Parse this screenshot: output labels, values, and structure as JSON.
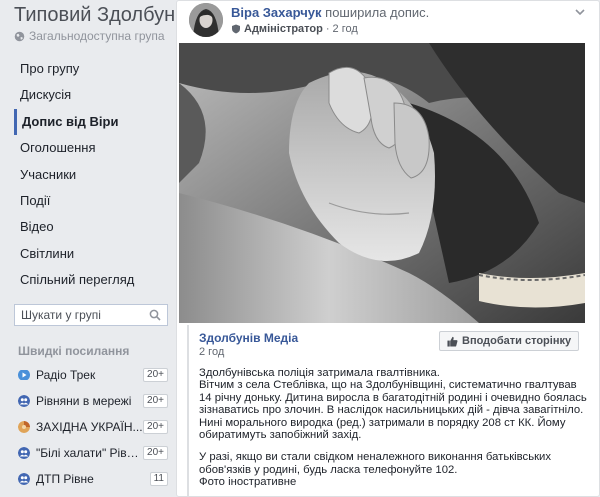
{
  "group": {
    "title": "Типовий Здолбунів",
    "privacy": "Загальнодоступна група"
  },
  "nav": [
    {
      "label": "Про групу",
      "active": false
    },
    {
      "label": "Дискусія",
      "active": false
    },
    {
      "label": "Допис від Віри",
      "active": true
    },
    {
      "label": "Оголошення",
      "active": false
    },
    {
      "label": "Учасники",
      "active": false
    },
    {
      "label": "Події",
      "active": false
    },
    {
      "label": "Відео",
      "active": false
    },
    {
      "label": "Світлини",
      "active": false
    },
    {
      "label": "Спільний перегляд",
      "active": false
    }
  ],
  "search": {
    "placeholder": "Шукати у групі"
  },
  "quick_links": {
    "title": "Швидкі посилання",
    "items": [
      {
        "label": "Радіо Трек",
        "badge": "20+",
        "icon": "video-icon",
        "color": "#4a90d9"
      },
      {
        "label": "Рівняни в мережі",
        "badge": "20+",
        "icon": "group-icon",
        "color": "#4267b2"
      },
      {
        "label": "ЗАХІДНА УКРАЇН...",
        "badge": "20+",
        "icon": "pie-icon",
        "color": "#d9822b"
      },
      {
        "label": "\"Білі халати\" Рівного",
        "badge": "20+",
        "icon": "group-icon",
        "color": "#4267b2"
      },
      {
        "label": "ДТП Рівне",
        "badge": "11",
        "icon": "group-icon",
        "color": "#4267b2"
      }
    ]
  },
  "post": {
    "author": "Віра Захарчук",
    "action": "поширила допис.",
    "role": "Адміністратор",
    "time": "2 год",
    "shared": {
      "page_name": "Здолбунів Медіа",
      "time": "2 год",
      "like_button": "Вподобати сторінку",
      "paragraphs": [
        "Здолбунівська поліція затримала гвалтівника.\nВітчим з села Стеблівка, що на Здолбунівщині, систематично гвалтував 14 річну доньку. Дитина виросла в багатодітній родині і очевидно боялась зізнаватись про злочин. В наслідок насильницьких дій - дівча завагітніло.\nНині морального виродка (ред.) затримали в порядку 208 ст КК. Йому обиратимуть запобіжний захід.",
        "У разі, якщо ви стали свідком неналежного виконання батьківських обов'язків у родині, будь ласка телефонуйте 102.\nФото іностративне"
      ]
    }
  },
  "colors": {
    "accent": "#4267b2",
    "link": "#385898",
    "background": "#e9ebee"
  }
}
